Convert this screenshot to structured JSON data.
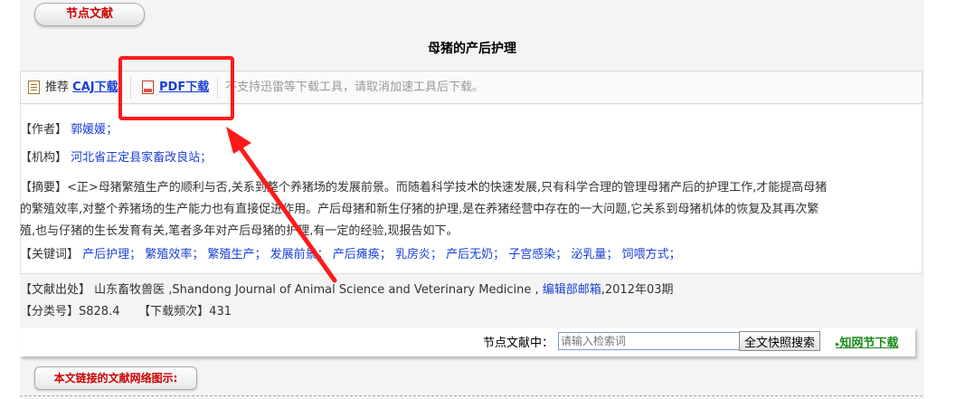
{
  "header": {
    "section_label": "节点文献",
    "article_title": "母猪的产后护理"
  },
  "toolbar": {
    "recommend_label": "推荐",
    "caj_link": "CAJ下载",
    "pdf_link": "PDF下载",
    "notice": "不支持迅雷等下载工具，请取消加速工具后下载。"
  },
  "details": {
    "author_label": "【作者】",
    "author_value": "郭媛媛；",
    "org_label": "【机构】",
    "org_value": "河北省正定县家畜改良站；",
    "abstract_label": "【摘要】",
    "abstract_line1": "<正>母猪繁殖生产的顺利与否,关系到整个养猪场的发展前景。而随着科学技术的快速发展,只有科学合理的管理母猪产后的护理工作,才能提高母猪",
    "abstract_line2": "的繁殖效率,对整个养猪场的生产能力也有直接促进作用。产后母猪和新生仔猪的护理,是在养猪经营中存在的一大问题,它关系到母猪机体的恢复及其再次繁",
    "abstract_line3": "殖,也与仔猪的生长发育有关,笔者多年对产后母猪的护理,有一定的经验,现报告如下。",
    "keywords_label": "【关键词】",
    "keywords": [
      "产后护理；",
      "繁殖效率；",
      "繁殖生产；",
      "发展前景；",
      "产后瘫痪；",
      "乳房炎；",
      "产后无奶；",
      "子宫感染；",
      "泌乳量；",
      "饲喂方式；"
    ]
  },
  "meta": {
    "source_label": "【文献出处】",
    "source_journal": "山东畜牧兽医 ,Shandong Journal of Animal Science and Veterinary Medicine ,",
    "source_editor_link": "编辑部邮箱",
    "source_date": ",2012年03期",
    "class_label": "【分类号】",
    "class_value": "S828.4",
    "downloads_label": "【下载频次】",
    "downloads_value": "431"
  },
  "search": {
    "label": "节点文献中：",
    "placeholder": "请输入检索词",
    "button": "全文快照搜索",
    "cnki_link": "知网节下载"
  },
  "bottom": {
    "network_button": "本文链接的文献网络图示:"
  },
  "colors": {
    "annotation": "#ff1a1a",
    "link": "#1a3fd6",
    "title_red": "#cc0000"
  }
}
